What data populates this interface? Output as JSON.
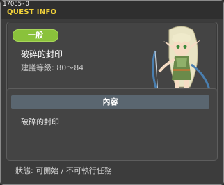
{
  "window": {
    "quest_id": "17085-0",
    "title": "QUEST INFO"
  },
  "summary": {
    "category": "一般",
    "quest_name": "破碎的封印",
    "level_label": "建議等級: 80～84"
  },
  "content": {
    "header": "內容",
    "text": "破碎的封印"
  },
  "status": {
    "text": "狀態: 可開始 / 不可執行任務"
  },
  "colors": {
    "title_yellow": "#f2d23a",
    "badge_green": "#8ac23b",
    "header_slate": "#5a6670",
    "panel_bg": "#444444",
    "window_bg": "#3c3c3c"
  },
  "icons": {
    "npc": "elf-archer-npc-portrait"
  }
}
